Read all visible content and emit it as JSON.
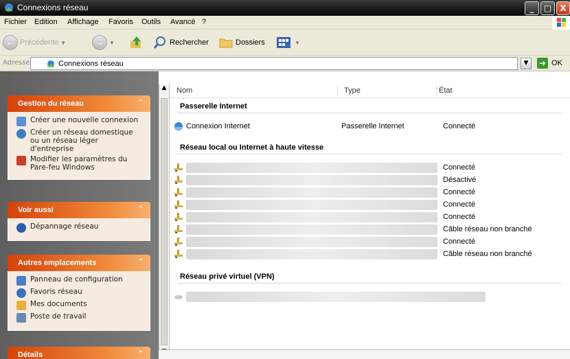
{
  "window": {
    "title": "Connexions réseau",
    "buttons": {
      "minimize": "_",
      "maximize": "□",
      "close": "X"
    }
  },
  "menu": {
    "items": [
      "Fichier",
      "Edition",
      "Affichage",
      "Favoris",
      "Outils",
      "Avancé",
      "?"
    ]
  },
  "toolbar": {
    "back_label": "Précédente",
    "search_label": "Rechercher",
    "folders_label": "Dossiers"
  },
  "address": {
    "label": "Adresse",
    "value": "Connexions réseau",
    "go_label": "OK"
  },
  "sidebar": {
    "network_tasks": {
      "title": "Gestion du réseau",
      "items": [
        "Créer une nouvelle connexion",
        "Créer un réseau domestique ou un réseau léger d'entreprise",
        "Modifier les paramètres du Pare-feu Windows"
      ]
    },
    "see_also": {
      "title": "Voir aussi",
      "items": [
        "Dépannage réseau"
      ]
    },
    "other_places": {
      "title": "Autres emplacements",
      "items": [
        "Panneau de configuration",
        "Favoris réseau",
        "Mes documents",
        "Poste de travail"
      ]
    },
    "details": {
      "title": "Détails"
    }
  },
  "list": {
    "columns": {
      "name": "Nom",
      "type": "Type",
      "state": "État"
    },
    "groups": [
      {
        "title": "Passerelle Internet",
        "rows": [
          {
            "name": "Connexion Internet",
            "type": "Passerelle Internet",
            "state": "Connecté"
          }
        ]
      },
      {
        "title": "Réseau local ou Internet à haute vitesse",
        "rows": [
          {
            "state": "Connecté"
          },
          {
            "state": "Désactivé"
          },
          {
            "state": "Connecté"
          },
          {
            "state": "Connecté"
          },
          {
            "state": "Connecté"
          },
          {
            "state": "Câble réseau non branché"
          },
          {
            "state": "Connecté"
          },
          {
            "state": "Câble réseau non branché"
          }
        ]
      },
      {
        "title": "Réseau privé virtuel (VPN)",
        "rows": [
          {}
        ]
      }
    ]
  }
}
